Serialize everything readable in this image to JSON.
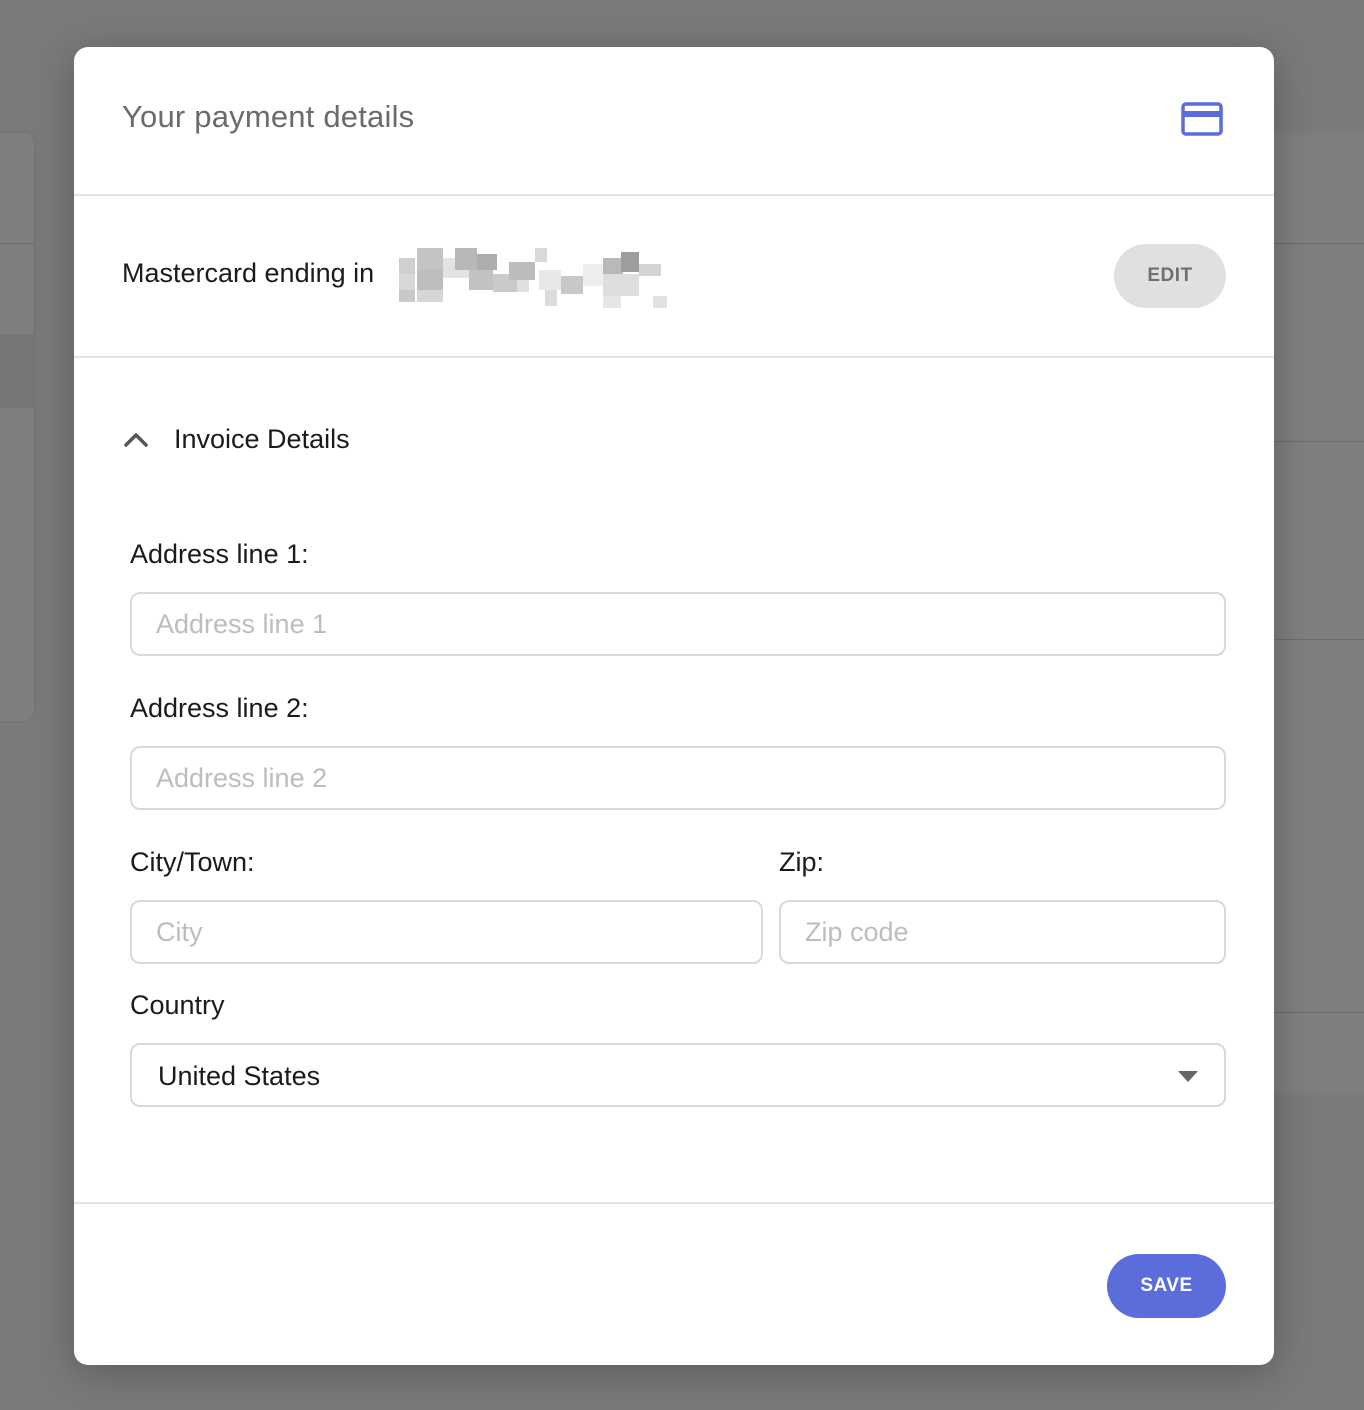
{
  "modal": {
    "title": "Your payment details",
    "title_icon": "credit-card-icon",
    "accent_color": "#5a6ddb"
  },
  "card": {
    "text": "Mastercard ending in",
    "digits_redacted": true,
    "edit_label": "EDIT"
  },
  "invoice": {
    "toggle_label": "Invoice Details",
    "toggle_icon": "chevron-up-icon",
    "expanded": true,
    "address1": {
      "label": "Address line 1:",
      "placeholder": "Address line 1",
      "value": ""
    },
    "address2": {
      "label": "Address line 2:",
      "placeholder": "Address line 2",
      "value": ""
    },
    "city": {
      "label": "City/Town:",
      "placeholder": "City",
      "value": ""
    },
    "zip": {
      "label": "Zip:",
      "placeholder": "Zip code",
      "value": ""
    },
    "country": {
      "label": "Country",
      "selected": "United States",
      "caret_icon": "caret-down-icon"
    }
  },
  "footer": {
    "save_label": "SAVE"
  }
}
